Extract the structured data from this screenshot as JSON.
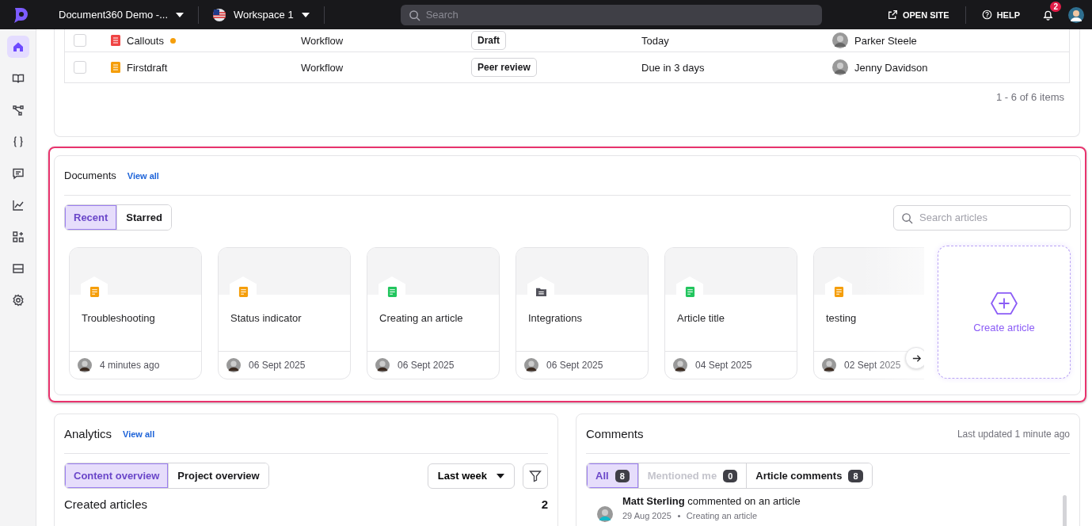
{
  "topbar": {
    "project": "Document360 Demo -...",
    "workspace": "Workspace 1",
    "search": {
      "placeholder": "Search"
    },
    "open_site": "OPEN SITE",
    "help": "HELP",
    "notifications": "2"
  },
  "sidebar": {
    "items": [
      {
        "kind": "home",
        "selected": true
      },
      {
        "kind": "book",
        "selected": false
      },
      {
        "kind": "diagram",
        "selected": false
      },
      {
        "kind": "braces",
        "selected": false
      },
      {
        "kind": "comment",
        "selected": false
      },
      {
        "kind": "chart",
        "selected": false
      },
      {
        "kind": "widgets",
        "selected": false
      },
      {
        "kind": "panel",
        "selected": false
      },
      {
        "kind": "settings",
        "selected": false
      }
    ]
  },
  "workflow_table": {
    "rows": [
      {
        "checked": false,
        "title": "Callouts",
        "color": "#ef4444",
        "dot": true,
        "type": "Workflow",
        "status": "Draft",
        "due": "Today",
        "assignee": "Parker Steele"
      },
      {
        "checked": false,
        "title": "Firstdraft",
        "color": "#f59e0b",
        "dot": false,
        "type": "Workflow",
        "status": "Peer review",
        "due": "Due in 3 days",
        "assignee": "Jenny Davidson"
      }
    ],
    "pagination": "1 - 6 of 6 items"
  },
  "documents": {
    "title": "Documents",
    "view_all": "View all",
    "tabs": [
      {
        "label": "Recent",
        "selected": true
      },
      {
        "label": "Starred",
        "selected": false
      }
    ],
    "search": {
      "placeholder": "Search articles"
    },
    "cards": [
      {
        "title": "Troubleshooting",
        "kind": "article",
        "color": "#f59e0b",
        "date": "4 minutes ago"
      },
      {
        "title": "Status indicator",
        "kind": "article",
        "color": "#f59e0b",
        "date": "06 Sept 2025"
      },
      {
        "title": "Creating an article",
        "kind": "article",
        "color": "#22c55e",
        "date": "06 Sept 2025"
      },
      {
        "title": "Integrations",
        "kind": "category",
        "color": "#52525b",
        "date": "06 Sept 2025"
      },
      {
        "title": "Article title",
        "kind": "article",
        "color": "#22c55e",
        "date": "04 Sept 2025"
      },
      {
        "title": "testing",
        "kind": "article",
        "color": "#f59e0b",
        "date": "02 Sept 2025"
      }
    ],
    "create": "Create article"
  },
  "analytics": {
    "title": "Analytics",
    "view_all": "View all",
    "tabs": [
      {
        "label": "Content overview",
        "selected": true
      },
      {
        "label": "Project overview",
        "selected": false
      }
    ],
    "period": "Last week",
    "metric": "Created articles",
    "count": "2"
  },
  "comments": {
    "title": "Comments",
    "updated": "Last updated 1 minute ago",
    "tabs": [
      {
        "label": "All",
        "count": "8",
        "selected": true,
        "disabled": false
      },
      {
        "label": "Mentioned me",
        "count": "0",
        "selected": false,
        "disabled": true
      },
      {
        "label": "Article comments",
        "count": "8",
        "selected": false,
        "disabled": false
      }
    ],
    "items": [
      {
        "author": "Matt Sterling",
        "action": "commented on an article",
        "date": "29 Aug 2025",
        "article": "Creating an article"
      }
    ]
  }
}
